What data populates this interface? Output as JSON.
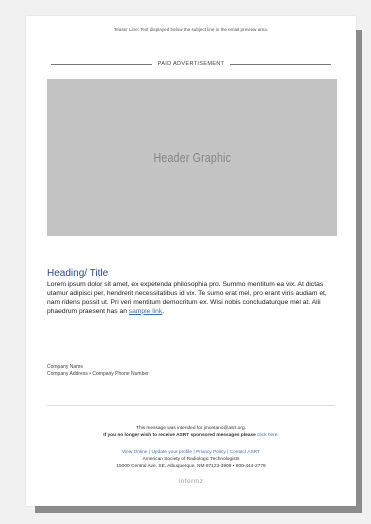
{
  "teaser": "Teaser Line: Text displayed below the subject line in the email preview area.",
  "paid_label": "PAID ADVERTISEMENT",
  "header_graphic_label": "Header Graphic",
  "heading": "Heading/ Title",
  "body_text": "Lorem ipsum dolor sit amet, ex expetenda philosophia pro. Summo mentitum ea vix. At dictas utamur adipisci per, hendrerit necessitatibus id vix. Te sumo erat mel, pro erant viris audiam et, nam ridens possit ut. Pri veri mentitum democritum ex. Wisi nobis concludaturque mel at. Alii phaedrum praesent has an",
  "sample_link": "sample link",
  "body_end": ".",
  "company_name": "Company Name",
  "company_address": "Company Address • Company Phone Number",
  "footer": {
    "intended": "This message was intended for jmontano@asrt.org.",
    "unsubscribe_text": "If you no longer wish to receive ASRT sponsored messages please",
    "click_here": "click here",
    "unsubscribe_end": ".",
    "links": "View Online | Update your profile | Privacy Policy | Contact ASRT",
    "org_name": "American Society of Radiologic Technologists",
    "org_address": "15000 Central Ave. SE, Albuquerque, NM 87123-3909 • 800-444-2778"
  },
  "brand": "informz",
  "colors": {
    "heading": "#2a4a8f",
    "link": "#3a72b8",
    "header_graphic_bg": "#c4c4c4"
  }
}
